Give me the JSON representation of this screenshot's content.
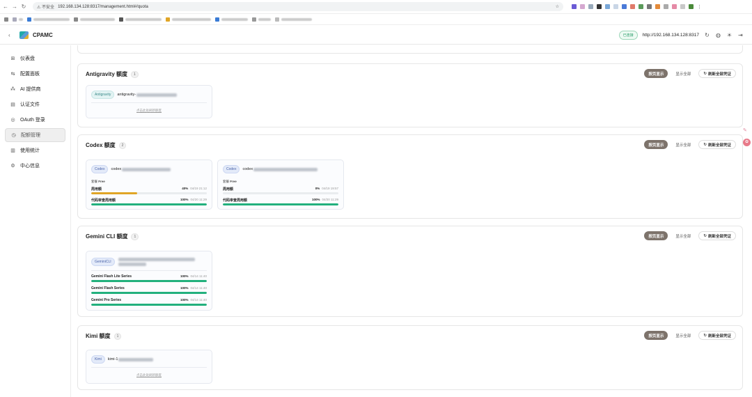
{
  "browser": {
    "security": "不安全",
    "url": "192.168.134.128:8317/management.html#/quota"
  },
  "app": {
    "brand": "CPAMC",
    "status_badge": "已连接",
    "server": "http://192.168.134.128:8317"
  },
  "sidebar": {
    "items": [
      {
        "label": "仪表盘",
        "icon": "dashboard-icon"
      },
      {
        "label": "配置面板",
        "icon": "sliders-icon"
      },
      {
        "label": "AI 提供商",
        "icon": "providers-icon"
      },
      {
        "label": "认证文件",
        "icon": "file-icon"
      },
      {
        "label": "OAuth 登录",
        "icon": "oauth-icon"
      },
      {
        "label": "配额管理",
        "icon": "quota-icon",
        "active": true
      },
      {
        "label": "使用统计",
        "icon": "chart-icon"
      },
      {
        "label": "中心信息",
        "icon": "info-icon"
      }
    ]
  },
  "buttons": {
    "paged": "按页显示",
    "all": "显示全部",
    "refresh": "刷新全部凭证"
  },
  "sections": {
    "antigravity": {
      "title": "Antigravity 额度",
      "count": "1",
      "card": {
        "tag": "Antigravity",
        "account": "antigravity-",
        "hint": "点击此处刷新额度"
      }
    },
    "codex": {
      "title": "Codex 额度",
      "count": "2",
      "cards": [
        {
          "tag": "Codex",
          "account": "codex",
          "plan_label": "套餐",
          "plan": "Free",
          "rows": [
            {
              "label": "周用额",
              "pct": "40%",
              "value": 40,
              "time": "04/19 21:12",
              "color": "#e0a526"
            },
            {
              "label": "代码审查周用额",
              "pct": "100%",
              "value": 100,
              "time": "04/20 11:29",
              "color": "#22b07d"
            }
          ]
        },
        {
          "tag": "Codex",
          "account": "codex",
          "plan_label": "套餐",
          "plan": "Free",
          "rows": [
            {
              "label": "周用额",
              "pct": "0%",
              "value": 0,
              "time": "04/19 19:57",
              "color": "#e05252"
            },
            {
              "label": "代码审查周用额",
              "pct": "100%",
              "value": 100,
              "time": "04/20 11:29",
              "color": "#22b07d"
            }
          ]
        }
      ]
    },
    "gemini": {
      "title": "Gemini CLI 额度",
      "count": "1",
      "card": {
        "tag": "GeminiCLI",
        "rows": [
          {
            "label": "Gemini Flash Lite Series",
            "pct": "100%",
            "value": 100,
            "time": "04/14 11:40",
            "color": "#22b07d"
          },
          {
            "label": "Gemini Flash Series",
            "pct": "100%",
            "value": 100,
            "time": "04/14 11:40",
            "color": "#22b07d"
          },
          {
            "label": "Gemini Pro Series",
            "pct": "100%",
            "value": 100,
            "time": "04/14 11:40",
            "color": "#22b07d"
          }
        ]
      }
    },
    "kimi": {
      "title": "Kimi 额度",
      "count": "1",
      "card": {
        "tag": "Kimi",
        "account": "kimi-1",
        "hint": "点击此处刷新额度"
      }
    }
  }
}
